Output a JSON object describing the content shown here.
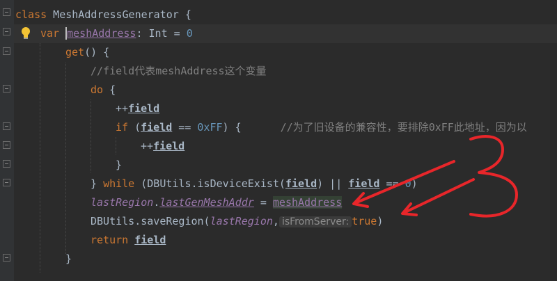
{
  "code": {
    "line1": {
      "kw": "class",
      "name": " MeshAddressGenerator {"
    },
    "line2": {
      "kw": "var",
      "name": "meshAddress",
      "type": ": Int = ",
      "num": "0"
    },
    "line3": {
      "fn": "get",
      "rest": "() {"
    },
    "line4": {
      "comment": "//field代表meshAddress这个变量"
    },
    "line5": {
      "kw": "do",
      "rest": " {"
    },
    "line6": {
      "op": "++",
      "field": "field"
    },
    "line7": {
      "kw": "if",
      "open": " (",
      "field": "field",
      "op": " == ",
      "num": "0xFF",
      "close": ") {",
      "comment": "//为了旧设备的兼容性，要排除0xFF此地址，因为以"
    },
    "line8": {
      "op": "++",
      "field": "field"
    },
    "line9": {
      "brace": "}"
    },
    "line10": {
      "brace": "} ",
      "kw": "while",
      "open": " (DBUtils.",
      "call": "isDeviceExist(",
      "field1": "field",
      "or": ") || ",
      "field2": "field",
      "eq": " == ",
      "num": "0",
      "close": ")"
    },
    "line11": {
      "obj": "lastRegion",
      "dot": ".",
      "prop": "lastGenMeshAddr",
      "eq": " = ",
      "val": "meshAddress"
    },
    "line12": {
      "call": "DBUtils.saveRegion(",
      "arg": "lastRegion",
      "comma": ",",
      "hint": "isFromServer:",
      "kw": "true",
      "close": ")"
    },
    "line13": {
      "kw": "return",
      "field": "field"
    },
    "line14": {
      "brace": "}"
    }
  },
  "annotation": {
    "color": "#e8262a",
    "label": "3"
  }
}
